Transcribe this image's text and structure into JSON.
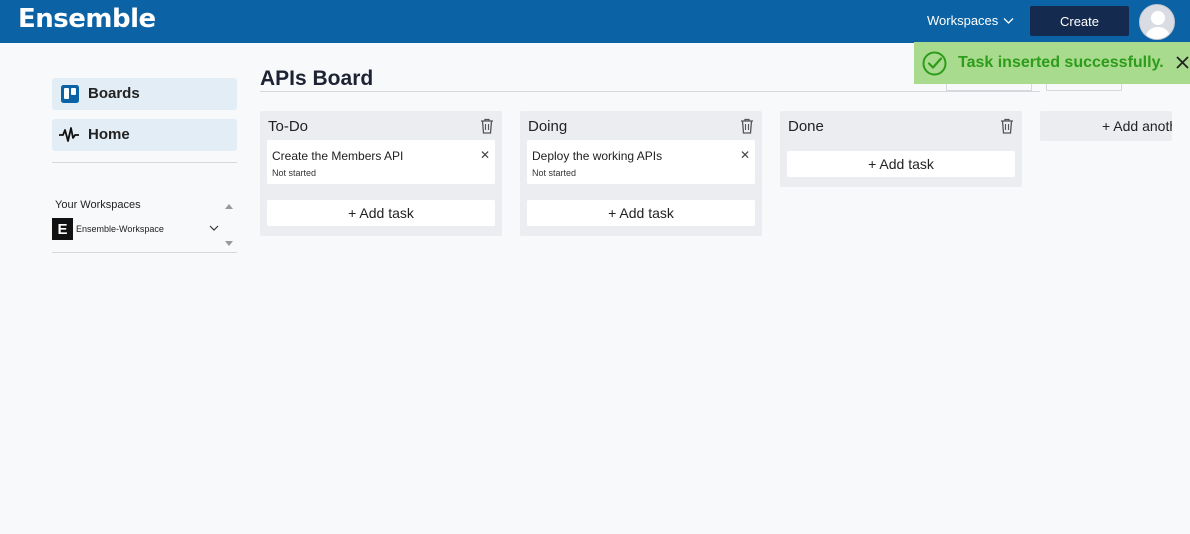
{
  "app": {
    "logo": "Ensemble"
  },
  "header": {
    "workspaces_label": "Workspaces",
    "create_label": "Create"
  },
  "sidebar": {
    "items": [
      {
        "label": "Boards",
        "icon": "trello-board-icon"
      },
      {
        "label": "Home",
        "icon": "pulse-icon"
      }
    ],
    "workspaces_heading": "Your Workspaces",
    "workspace": {
      "badge": "E",
      "name": "Ensemble-Workspace"
    }
  },
  "board": {
    "title": "APIs Board",
    "columns": [
      {
        "title": "To-Do",
        "tasks": [
          {
            "title": "Create the Members API",
            "status": "Not started"
          }
        ],
        "add_label": "+ Add task"
      },
      {
        "title": "Doing",
        "tasks": [
          {
            "title": "Deploy the working APIs",
            "status": "Not started"
          }
        ],
        "add_label": "+ Add task"
      },
      {
        "title": "Done",
        "tasks": [],
        "add_label": "+ Add task"
      }
    ],
    "add_list_label": "+ Add another list"
  },
  "toast": {
    "message": "Task inserted successfully.",
    "type": "success"
  },
  "colors": {
    "header_bg": "#0b63a5",
    "create_button": "#142a4f",
    "toast_bg": "#a9db8e",
    "toast_text": "#2c9c1a"
  }
}
